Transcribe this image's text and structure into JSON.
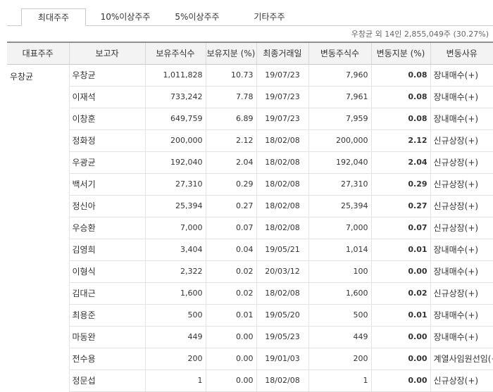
{
  "tabs": [
    {
      "label": "최대주주",
      "active": true
    },
    {
      "label": "10%이상주주",
      "active": false
    },
    {
      "label": "5%이상주주",
      "active": false
    },
    {
      "label": "기타주주",
      "active": false
    }
  ],
  "summary": "우창균 외 14인 2,855,049주 (30.27%)",
  "columns": [
    "대표주주",
    "보고자",
    "보유주식수",
    "보유지분 (%)",
    "최종거래일",
    "변동주식수",
    "변동지분 (%)",
    "변동사유"
  ],
  "representative": "우창균",
  "rows": [
    {
      "reporter": "우창균",
      "shares": "1,011,828",
      "stake": "10.73",
      "date": "19/07/23",
      "change_shares": "7,960",
      "change_stake": "0.08",
      "reason": "장내매수(+)"
    },
    {
      "reporter": "이재석",
      "shares": "733,242",
      "stake": "7.78",
      "date": "19/07/23",
      "change_shares": "7,961",
      "change_stake": "0.08",
      "reason": "장내매수(+)"
    },
    {
      "reporter": "이창훈",
      "shares": "649,759",
      "stake": "6.89",
      "date": "19/07/23",
      "change_shares": "7,959",
      "change_stake": "0.08",
      "reason": "장내매수(+)"
    },
    {
      "reporter": "정화정",
      "shares": "200,000",
      "stake": "2.12",
      "date": "18/02/08",
      "change_shares": "200,000",
      "change_stake": "2.12",
      "reason": "신규상장(+)"
    },
    {
      "reporter": "우광균",
      "shares": "192,040",
      "stake": "2.04",
      "date": "18/02/08",
      "change_shares": "192,040",
      "change_stake": "2.04",
      "reason": "신규상장(+)"
    },
    {
      "reporter": "백서기",
      "shares": "27,310",
      "stake": "0.29",
      "date": "18/02/08",
      "change_shares": "27,310",
      "change_stake": "0.29",
      "reason": "신규상장(+)"
    },
    {
      "reporter": "정신아",
      "shares": "25,394",
      "stake": "0.27",
      "date": "18/02/08",
      "change_shares": "25,394",
      "change_stake": "0.27",
      "reason": "신규상장(+)"
    },
    {
      "reporter": "우승환",
      "shares": "7,000",
      "stake": "0.07",
      "date": "18/02/08",
      "change_shares": "7,000",
      "change_stake": "0.07",
      "reason": "신규상장(+)"
    },
    {
      "reporter": "김영희",
      "shares": "3,404",
      "stake": "0.04",
      "date": "19/05/21",
      "change_shares": "1,014",
      "change_stake": "0.01",
      "reason": "장내매수(+)"
    },
    {
      "reporter": "이형식",
      "shares": "2,322",
      "stake": "0.02",
      "date": "20/03/12",
      "change_shares": "100",
      "change_stake": "0.00",
      "reason": "장내매수(+)"
    },
    {
      "reporter": "김대근",
      "shares": "1,600",
      "stake": "0.02",
      "date": "18/02/08",
      "change_shares": "1,600",
      "change_stake": "0.02",
      "reason": "신규상장(+)"
    },
    {
      "reporter": "최용준",
      "shares": "500",
      "stake": "0.01",
      "date": "19/05/20",
      "change_shares": "500",
      "change_stake": "0.01",
      "reason": "장내매수(+)"
    },
    {
      "reporter": "마동완",
      "shares": "449",
      "stake": "0.00",
      "date": "19/05/23",
      "change_shares": "449",
      "change_stake": "0.00",
      "reason": "장내매수(+)"
    },
    {
      "reporter": "전수용",
      "shares": "200",
      "stake": "0.00",
      "date": "19/01/03",
      "change_shares": "200",
      "change_stake": "0.00",
      "reason": "계열사임원선임(+)"
    },
    {
      "reporter": "정문섭",
      "shares": "1",
      "stake": "0.00",
      "date": "18/02/08",
      "change_shares": "1",
      "change_stake": "0.00",
      "reason": "신규상장(+)"
    }
  ]
}
